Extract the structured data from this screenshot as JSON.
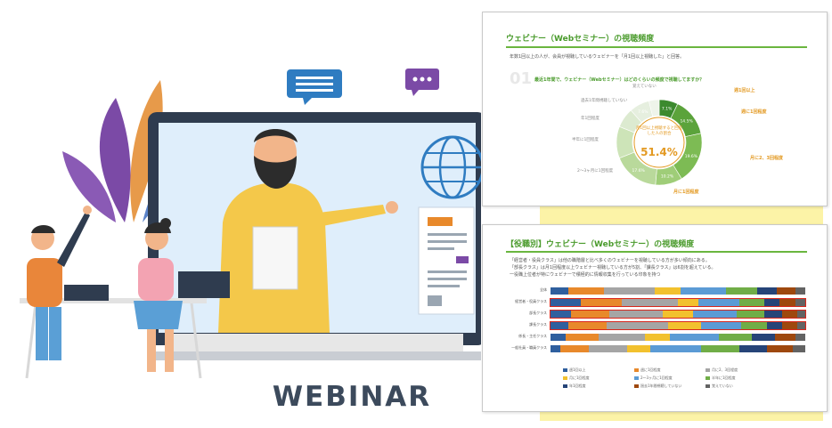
{
  "banner": {
    "label": "WEBINAR"
  },
  "slide_top": {
    "title": "ウェビナー（Webセミナー）の視聴頻度",
    "bullet": "年数1回以上の人が、会員が視聴しているウェビナーを「月1回以上視聴した」と回答。",
    "question": "最近1年間で、ウェビナー（Webセミナー）はどのくらいの頻度で視聴してますか？",
    "watermark": "01",
    "center_caption": "月1回以上視聴すると回答した人の割合",
    "center_value": "51.4%",
    "chart_data": {
      "type": "pie",
      "labels": [
        "週1回以上",
        "週に1回程度",
        "月に2、3回程度",
        "月に1回程度",
        "2〜3ヶ月に1回程度",
        "半年に1回程度",
        "年1回程度",
        "過去1年間視聴していない",
        "覚えていない"
      ],
      "values": [
        7.1,
        14.5,
        19.6,
        10.2,
        17.6,
        12.0,
        7.5,
        7.6,
        3.9
      ],
      "value_labels": [
        "7.1%",
        "14.5%",
        "19.6%",
        "10.2%",
        "17.6%",
        "",
        "",
        "7.6%",
        ""
      ],
      "colors": [
        "#3c8a2e",
        "#5ba33b",
        "#7dbb54",
        "#9fcd78",
        "#b9d99b",
        "#cde4b8",
        "#dcead0",
        "#e6efdf",
        "#eef4ea"
      ]
    },
    "callouts": {
      "weekly": "週1回以上",
      "once_week": "週に1回程度",
      "two_three_month": "月に2、3回程度",
      "once_month": "月に1回程度"
    }
  },
  "slide_bottom": {
    "title": "【役職別】ウェビナー（Webセミナー）の視聴頻度",
    "bullets": [
      "「経営者・役員クラス」は他の職階層と比べ多くのウェビナーを視聴している方が多い傾向にある。",
      "「部長クラス」は月1回程度以上ウェビナー視聴している方が5割、「課長クラス」は6割を超えている。",
      "一役職上位者が特にウェビナーで積極的に情報収集を行っている印象を持つ"
    ],
    "chart_data": {
      "type": "bar",
      "orientation": "horizontal-stacked-100",
      "categories": [
        "全体",
        "経営者・役員クラス",
        "部長クラス",
        "課長クラス",
        "係長・主任クラス",
        "一般社員・職員クラス"
      ],
      "series": [
        {
          "name": "週1回以上",
          "values": [
            7,
            12,
            8,
            7,
            6,
            4
          ]
        },
        {
          "name": "週に1回程度",
          "values": [
            14,
            16,
            15,
            15,
            13,
            11
          ]
        },
        {
          "name": "月に2、3回程度",
          "values": [
            20,
            22,
            21,
            24,
            18,
            15
          ]
        },
        {
          "name": "月に1回程度",
          "values": [
            10,
            8,
            12,
            13,
            10,
            9
          ]
        },
        {
          "name": "2〜3ヶ月に1回程度",
          "values": [
            18,
            16,
            17,
            16,
            19,
            20
          ]
        },
        {
          "name": "半年に1回程度",
          "values": [
            12,
            10,
            11,
            10,
            13,
            15
          ]
        },
        {
          "name": "年1回程度",
          "values": [
            8,
            6,
            7,
            6,
            9,
            11
          ]
        },
        {
          "name": "過去1年間視聴していない",
          "values": [
            7,
            6,
            6,
            6,
            8,
            10
          ]
        },
        {
          "name": "覚えていない",
          "values": [
            4,
            4,
            3,
            3,
            4,
            5
          ]
        }
      ],
      "colors": [
        "#2f5f9e",
        "#e8892b",
        "#a5a5a5",
        "#f2c12e",
        "#5b9bd5",
        "#70ad47",
        "#264478",
        "#9e480e",
        "#636363"
      ]
    }
  }
}
